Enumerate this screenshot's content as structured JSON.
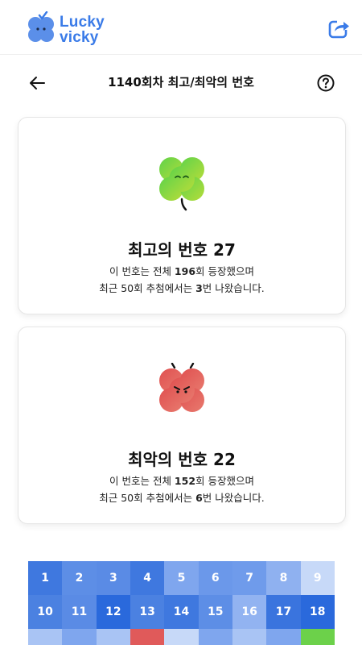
{
  "brand": {
    "line1": "Lucky",
    "line2": "vicky",
    "color": "#3a7be8"
  },
  "icons": {
    "share": "share-icon",
    "back": "arrow-left-icon",
    "help": "question-circle-icon"
  },
  "header": {
    "title": "1140회차 최고/최악의 번호"
  },
  "best": {
    "title": "최고의 번호 27",
    "desc1_pre": "이 번호는 전체 ",
    "desc1_count": "196",
    "desc1_post": "회 등장했으며",
    "desc2_pre": "최근 50회 추첨에서는 ",
    "desc2_count": "3",
    "desc2_post": "번 나왔습니다.",
    "icon": "happy-green-clover-icon",
    "color": "#6cd14a"
  },
  "worst": {
    "title": "최악의 번호 22",
    "desc1_pre": "이 번호는 전체 ",
    "desc1_count": "152",
    "desc1_post": "회 등장했으며",
    "desc2_pre": "최근 50회 추첨에서는 ",
    "desc2_count": "6",
    "desc2_post": "번 나왔습니다.",
    "icon": "angry-red-clover-icon",
    "color": "#e05a5a"
  },
  "grid": {
    "cells": [
      {
        "n": "1",
        "c": "#3f78df"
      },
      {
        "n": "2",
        "c": "#5d8ee6"
      },
      {
        "n": "3",
        "c": "#5a8be5"
      },
      {
        "n": "4",
        "c": "#3f78df"
      },
      {
        "n": "5",
        "c": "#7fa6ee"
      },
      {
        "n": "6",
        "c": "#6b98ea"
      },
      {
        "n": "7",
        "c": "#6f9beb"
      },
      {
        "n": "8",
        "c": "#8fb1f0"
      },
      {
        "n": "9",
        "c": "#c7d9f8"
      },
      {
        "n": "10",
        "c": "#4b81e1"
      },
      {
        "n": "11",
        "c": "#5a8be5"
      },
      {
        "n": "12",
        "c": "#2a69dc"
      },
      {
        "n": "13",
        "c": "#4b81e1"
      },
      {
        "n": "14",
        "c": "#3f78df"
      },
      {
        "n": "15",
        "c": "#5d8ee6"
      },
      {
        "n": "16",
        "c": "#92b3f1"
      },
      {
        "n": "17",
        "c": "#3a74de"
      },
      {
        "n": "18",
        "c": "#2a69dc"
      },
      {
        "n": "",
        "c": "#a9c4f4"
      },
      {
        "n": "",
        "c": "#7fa6ee"
      },
      {
        "n": "",
        "c": "#a9c4f4"
      },
      {
        "n": "",
        "c": "#e05a5a"
      },
      {
        "n": "",
        "c": "#c7d9f8"
      },
      {
        "n": "",
        "c": "#7fa6ee"
      },
      {
        "n": "",
        "c": "#a9c4f4"
      },
      {
        "n": "",
        "c": "#7fa6ee"
      },
      {
        "n": "",
        "c": "#6cd14a"
      }
    ]
  }
}
